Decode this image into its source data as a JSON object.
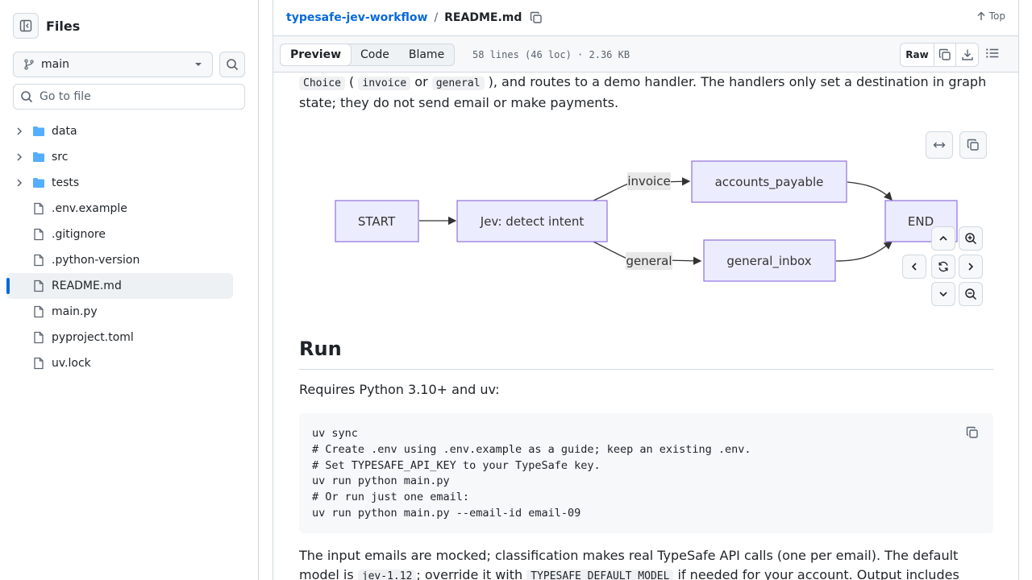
{
  "sidebar": {
    "title": "Files",
    "branch": "main",
    "goto_placeholder": "Go to file",
    "items": [
      {
        "label": "data",
        "type": "folder"
      },
      {
        "label": "src",
        "type": "folder"
      },
      {
        "label": "tests",
        "type": "folder"
      },
      {
        "label": ".env.example",
        "type": "file"
      },
      {
        "label": ".gitignore",
        "type": "file"
      },
      {
        "label": ".python-version",
        "type": "file"
      },
      {
        "label": "README.md",
        "type": "file",
        "selected": true
      },
      {
        "label": "main.py",
        "type": "file"
      },
      {
        "label": "pyproject.toml",
        "type": "file"
      },
      {
        "label": "uv.lock",
        "type": "file"
      }
    ]
  },
  "header": {
    "repo": "typesafe-jev-workflow",
    "separator": "/",
    "file": "README.md",
    "top_label": "Top"
  },
  "toolbar": {
    "tabs": [
      "Preview",
      "Code",
      "Blame"
    ],
    "active_tab": "Preview",
    "meta": "58 lines (46 loc) · 2.36 KB",
    "raw_label": "Raw"
  },
  "content": {
    "para1": {
      "code1": "Choice",
      "t1": " ( ",
      "code2": "invoice",
      "t2": " or ",
      "code3": "general",
      "t3": " ), and routes to a demo handler. The handlers only set a destination in graph state; they do not send email or make payments."
    },
    "diagram": {
      "nodes": {
        "start": "START",
        "detect": "Jev: detect intent",
        "accounts": "accounts_payable",
        "inbox": "general_inbox",
        "end": "END"
      },
      "edges": {
        "invoice": "invoice",
        "general": "general"
      }
    },
    "run_heading": "Run",
    "requires": "Requires Python 3.10+ and uv:",
    "code_lines": "uv sync\n# Create .env using .env.example as a guide; keep an existing .env.\n# Set TYPESAFE_API_KEY to your TypeSafe key.\nuv run python main.py\n# Or run just one email:\nuv run python main.py --email-id email-09",
    "para2": {
      "t1": "The input emails are mocked; classification makes real TypeSafe API calls (one per email). The default model is ",
      "code1": "jev-1.12",
      "t2": "; override it with ",
      "code2": "TYPESAFE_DEFAULT_MODEL",
      "t3": " if needed for your account. Output includes"
    }
  },
  "colors": {
    "accent": "#0969da",
    "node_fill": "#ECECFF",
    "node_stroke": "#9370DB",
    "folder": "#54aeff"
  }
}
